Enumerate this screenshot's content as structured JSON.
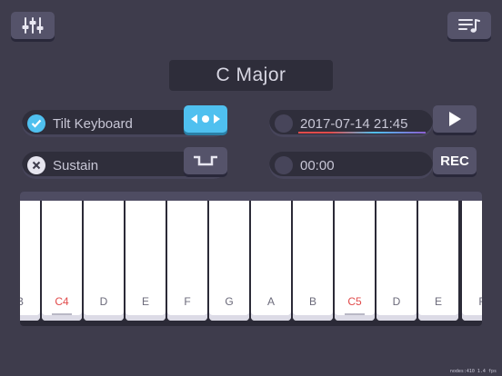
{
  "header": {
    "title": "C Major",
    "mixer_icon": "sliders-icon",
    "playlist_icon": "playlist-icon"
  },
  "controls": {
    "tilt": {
      "label": "Tilt Keyboard",
      "checked": true,
      "toggle_icon": "tilt-arrows-icon"
    },
    "sustain": {
      "label": "Sustain",
      "checked": false,
      "toggle_icon": "sustain-pedal-icon"
    },
    "recording": {
      "label": "2017-07-14 21:45",
      "play_icon": "play-icon"
    },
    "record": {
      "time": "00:00",
      "rec_label": "REC"
    }
  },
  "keyboard": {
    "keys": [
      "B",
      "C4",
      "D",
      "E",
      "F",
      "G",
      "A",
      "B",
      "C5",
      "D",
      "E",
      "F"
    ]
  },
  "debug": {
    "fps_text": "nodes:410  1.4 fps"
  },
  "colors": {
    "background": "#3e3c4c",
    "accent_blue": "#4fc0ef",
    "c_note_red": "#e14b4b"
  }
}
